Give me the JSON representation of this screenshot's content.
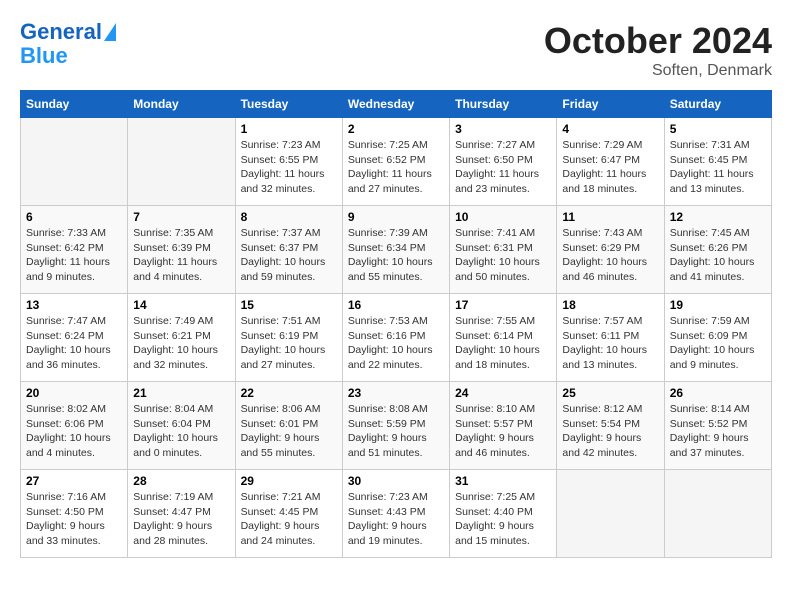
{
  "header": {
    "logo_line1": "General",
    "logo_line2": "Blue",
    "title": "October 2024",
    "subtitle": "Soften, Denmark"
  },
  "days_of_week": [
    "Sunday",
    "Monday",
    "Tuesday",
    "Wednesday",
    "Thursday",
    "Friday",
    "Saturday"
  ],
  "weeks": [
    [
      {
        "day": "",
        "info": ""
      },
      {
        "day": "",
        "info": ""
      },
      {
        "day": "1",
        "info": "Sunrise: 7:23 AM\nSunset: 6:55 PM\nDaylight: 11 hours and 32 minutes."
      },
      {
        "day": "2",
        "info": "Sunrise: 7:25 AM\nSunset: 6:52 PM\nDaylight: 11 hours and 27 minutes."
      },
      {
        "day": "3",
        "info": "Sunrise: 7:27 AM\nSunset: 6:50 PM\nDaylight: 11 hours and 23 minutes."
      },
      {
        "day": "4",
        "info": "Sunrise: 7:29 AM\nSunset: 6:47 PM\nDaylight: 11 hours and 18 minutes."
      },
      {
        "day": "5",
        "info": "Sunrise: 7:31 AM\nSunset: 6:45 PM\nDaylight: 11 hours and 13 minutes."
      }
    ],
    [
      {
        "day": "6",
        "info": "Sunrise: 7:33 AM\nSunset: 6:42 PM\nDaylight: 11 hours and 9 minutes."
      },
      {
        "day": "7",
        "info": "Sunrise: 7:35 AM\nSunset: 6:39 PM\nDaylight: 11 hours and 4 minutes."
      },
      {
        "day": "8",
        "info": "Sunrise: 7:37 AM\nSunset: 6:37 PM\nDaylight: 10 hours and 59 minutes."
      },
      {
        "day": "9",
        "info": "Sunrise: 7:39 AM\nSunset: 6:34 PM\nDaylight: 10 hours and 55 minutes."
      },
      {
        "day": "10",
        "info": "Sunrise: 7:41 AM\nSunset: 6:31 PM\nDaylight: 10 hours and 50 minutes."
      },
      {
        "day": "11",
        "info": "Sunrise: 7:43 AM\nSunset: 6:29 PM\nDaylight: 10 hours and 46 minutes."
      },
      {
        "day": "12",
        "info": "Sunrise: 7:45 AM\nSunset: 6:26 PM\nDaylight: 10 hours and 41 minutes."
      }
    ],
    [
      {
        "day": "13",
        "info": "Sunrise: 7:47 AM\nSunset: 6:24 PM\nDaylight: 10 hours and 36 minutes."
      },
      {
        "day": "14",
        "info": "Sunrise: 7:49 AM\nSunset: 6:21 PM\nDaylight: 10 hours and 32 minutes."
      },
      {
        "day": "15",
        "info": "Sunrise: 7:51 AM\nSunset: 6:19 PM\nDaylight: 10 hours and 27 minutes."
      },
      {
        "day": "16",
        "info": "Sunrise: 7:53 AM\nSunset: 6:16 PM\nDaylight: 10 hours and 22 minutes."
      },
      {
        "day": "17",
        "info": "Sunrise: 7:55 AM\nSunset: 6:14 PM\nDaylight: 10 hours and 18 minutes."
      },
      {
        "day": "18",
        "info": "Sunrise: 7:57 AM\nSunset: 6:11 PM\nDaylight: 10 hours and 13 minutes."
      },
      {
        "day": "19",
        "info": "Sunrise: 7:59 AM\nSunset: 6:09 PM\nDaylight: 10 hours and 9 minutes."
      }
    ],
    [
      {
        "day": "20",
        "info": "Sunrise: 8:02 AM\nSunset: 6:06 PM\nDaylight: 10 hours and 4 minutes."
      },
      {
        "day": "21",
        "info": "Sunrise: 8:04 AM\nSunset: 6:04 PM\nDaylight: 10 hours and 0 minutes."
      },
      {
        "day": "22",
        "info": "Sunrise: 8:06 AM\nSunset: 6:01 PM\nDaylight: 9 hours and 55 minutes."
      },
      {
        "day": "23",
        "info": "Sunrise: 8:08 AM\nSunset: 5:59 PM\nDaylight: 9 hours and 51 minutes."
      },
      {
        "day": "24",
        "info": "Sunrise: 8:10 AM\nSunset: 5:57 PM\nDaylight: 9 hours and 46 minutes."
      },
      {
        "day": "25",
        "info": "Sunrise: 8:12 AM\nSunset: 5:54 PM\nDaylight: 9 hours and 42 minutes."
      },
      {
        "day": "26",
        "info": "Sunrise: 8:14 AM\nSunset: 5:52 PM\nDaylight: 9 hours and 37 minutes."
      }
    ],
    [
      {
        "day": "27",
        "info": "Sunrise: 7:16 AM\nSunset: 4:50 PM\nDaylight: 9 hours and 33 minutes."
      },
      {
        "day": "28",
        "info": "Sunrise: 7:19 AM\nSunset: 4:47 PM\nDaylight: 9 hours and 28 minutes."
      },
      {
        "day": "29",
        "info": "Sunrise: 7:21 AM\nSunset: 4:45 PM\nDaylight: 9 hours and 24 minutes."
      },
      {
        "day": "30",
        "info": "Sunrise: 7:23 AM\nSunset: 4:43 PM\nDaylight: 9 hours and 19 minutes."
      },
      {
        "day": "31",
        "info": "Sunrise: 7:25 AM\nSunset: 4:40 PM\nDaylight: 9 hours and 15 minutes."
      },
      {
        "day": "",
        "info": ""
      },
      {
        "day": "",
        "info": ""
      }
    ]
  ]
}
